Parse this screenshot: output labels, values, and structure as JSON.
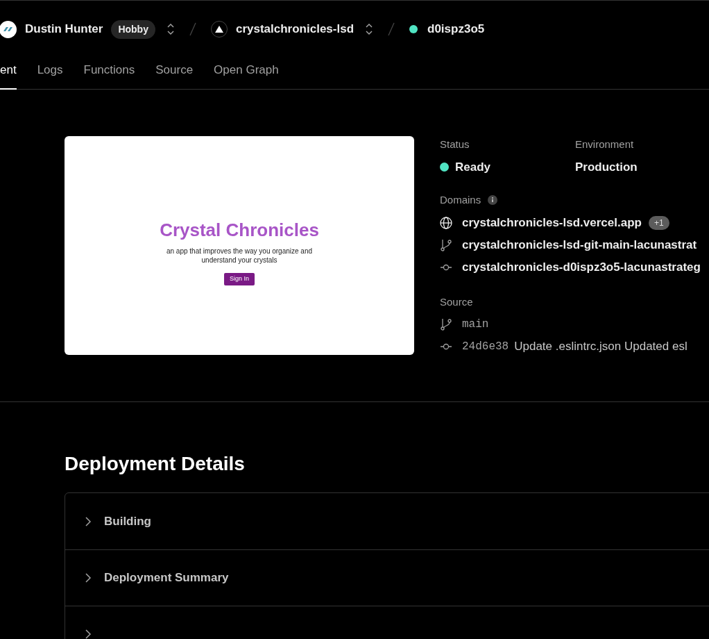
{
  "header": {
    "team": "Dustin Hunter",
    "plan": "Hobby",
    "project": "crystalchronicles-lsd",
    "deployment": {
      "id": "d0ispz3o5",
      "color": "#50e3c2"
    }
  },
  "tabs": [
    {
      "label": "ent",
      "selected": true
    },
    {
      "label": "Logs",
      "selected": false
    },
    {
      "label": "Functions",
      "selected": false
    },
    {
      "label": "Source",
      "selected": false
    },
    {
      "label": "Open Graph",
      "selected": false
    }
  ],
  "preview": {
    "title": "Crystal Chronicles",
    "subtitle": "an app that improves the way you organize and understand your crystals",
    "button": "Sign In"
  },
  "status": {
    "label": "Status",
    "value": "Ready",
    "color": "#50e3c2"
  },
  "environment": {
    "label": "Environment",
    "value": "Production"
  },
  "domains": {
    "label": "Domains",
    "items": [
      {
        "kind": "globe",
        "text": "crystalchronicles-lsd.vercel.app",
        "badge": "+1"
      },
      {
        "kind": "branch",
        "text": "crystalchronicles-lsd-git-main-lacunastrat"
      },
      {
        "kind": "commit",
        "text": "crystalchronicles-d0ispz3o5-lacunastrateg"
      }
    ]
  },
  "source": {
    "label": "Source",
    "branch": "main",
    "commit_hash": "24d6e38",
    "commit_message": "Update .eslintrc.json Updated esl"
  },
  "details": {
    "title": "Deployment Details",
    "sections": [
      {
        "label": "Building",
        "expanded": false
      },
      {
        "label": "Deployment Summary",
        "expanded": false
      },
      {
        "expanded": false
      }
    ]
  }
}
